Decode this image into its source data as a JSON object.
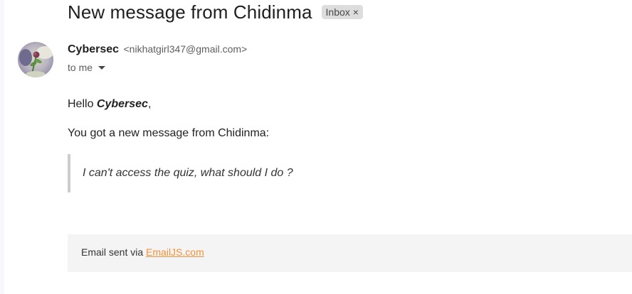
{
  "email": {
    "subject": "New message from Chidinma",
    "label": {
      "text": "Inbox",
      "close_icon": "close-icon",
      "close_glyph": "×"
    },
    "sender": {
      "name": "Cybersec",
      "email": "<nikhatgirl347@gmail.com>"
    },
    "recipient": {
      "text": "to me",
      "icon": "caret-down-icon"
    },
    "body": {
      "greeting_prefix": "Hello ",
      "greeting_name": "Cybersec",
      "greeting_suffix": ",",
      "intro": "You got a new message from Chidinma:",
      "quote": "I can't access the quiz, what should I do ?"
    },
    "footer": {
      "text": "Email sent via ",
      "link_text": "EmailJS.com"
    }
  },
  "colors": {
    "label_chip_bg": "#dddddd",
    "quote_bar": "#cccccc",
    "footer_bg": "#f4f4f4",
    "link": "#f0923c"
  }
}
